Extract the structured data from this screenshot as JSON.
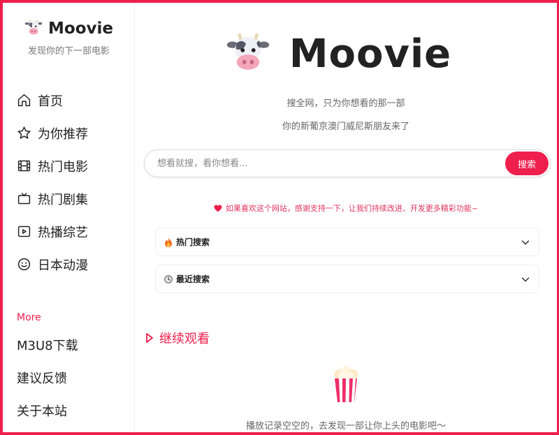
{
  "brand": {
    "name": "Moovie",
    "tagline": "发现你的下一部电影"
  },
  "nav": [
    {
      "label": "首页",
      "icon": "home-icon"
    },
    {
      "label": "为你推荐",
      "icon": "star-icon"
    },
    {
      "label": "热门电影",
      "icon": "film-icon"
    },
    {
      "label": "热门剧集",
      "icon": "tv-icon"
    },
    {
      "label": "热播综艺",
      "icon": "play-icon"
    },
    {
      "label": "日本动漫",
      "icon": "smile-icon"
    }
  ],
  "more": {
    "label": "More",
    "items": [
      "M3U8下载",
      "建议反馈",
      "关于本站"
    ]
  },
  "hero": {
    "title": "Moovie",
    "subtitle1": "搜全网，只为你想看的那一部",
    "subtitle2": "你的新葡京澳门威尼斯朋友来了"
  },
  "search": {
    "placeholder": "想看就搜，看你想看...",
    "value": "",
    "button": "搜索"
  },
  "support": {
    "text": "如果喜欢这个网站，感谢支持一下，让我们持续改进、开发更多精彩功能~"
  },
  "sections": {
    "hot_search": "热门搜索",
    "recent_search": "最近搜索"
  },
  "continue": {
    "title": "继续观看",
    "empty": "播放记录空空的，去发现一部让你上头的电影吧～"
  },
  "colors": {
    "accent": "#ef1f4d",
    "text": "#222222",
    "muted": "#666666"
  }
}
